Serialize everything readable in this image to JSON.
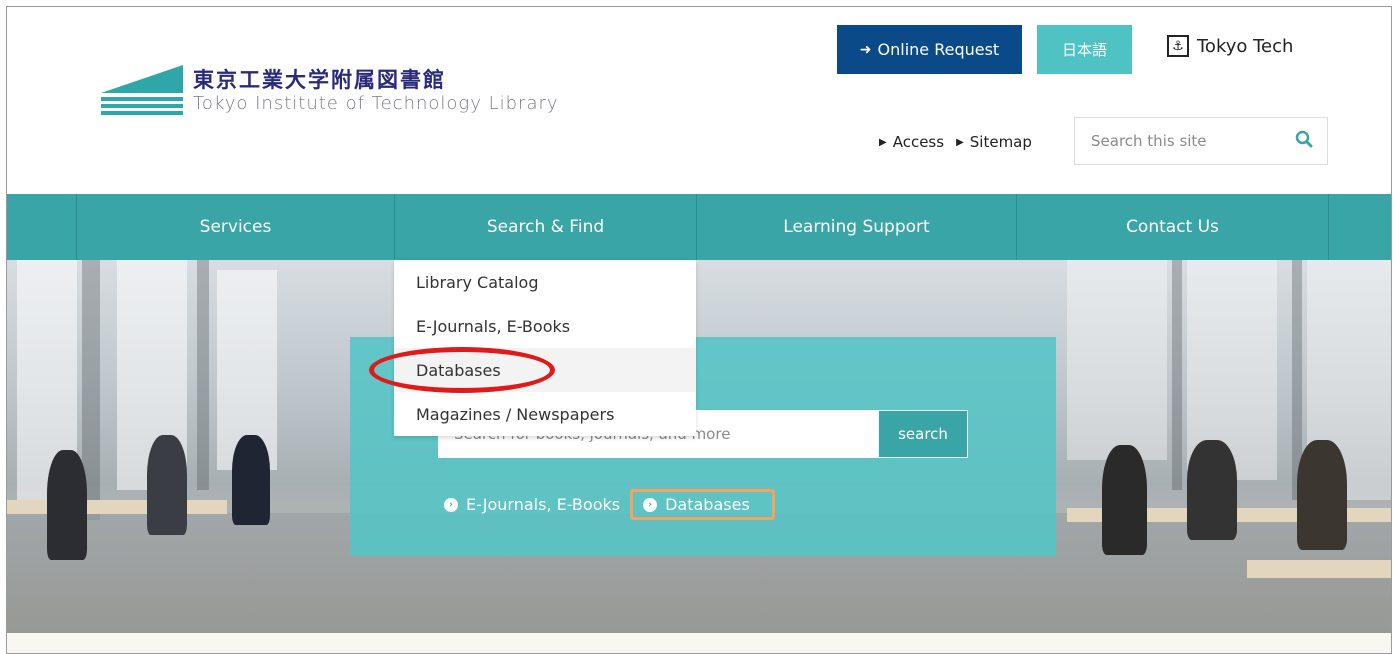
{
  "header": {
    "logo_jp": "東京工業大学附属図書館",
    "logo_en": "Tokyo Institute of Technology Library",
    "online_request": "Online Request",
    "lang_button": "日本語",
    "tokyotech_label": "Tokyo Tech",
    "access_link": "Access",
    "sitemap_link": "Sitemap",
    "site_search_placeholder": "Search this site"
  },
  "nav": {
    "items": [
      {
        "label": "Services"
      },
      {
        "label": "Search & Find"
      },
      {
        "label": "Learning Support"
      },
      {
        "label": "Contact Us"
      }
    ]
  },
  "dropdown": {
    "items": [
      {
        "label": "Library Catalog"
      },
      {
        "label": "E-Journals, E-Books"
      },
      {
        "label": "Databases"
      },
      {
        "label": "Magazines / Newspapers"
      }
    ]
  },
  "hero": {
    "search_placeholder": "Search for books, journals, and more",
    "search_button": "search",
    "links": [
      "E-Journals, E-Books",
      "Databases"
    ]
  },
  "colors": {
    "brand_teal": "#3aa5a6",
    "navy": "#0b4a88",
    "light_teal": "#4fc2c3",
    "highlight_red": "#e01919",
    "highlight_orange": "#f4a45f"
  }
}
